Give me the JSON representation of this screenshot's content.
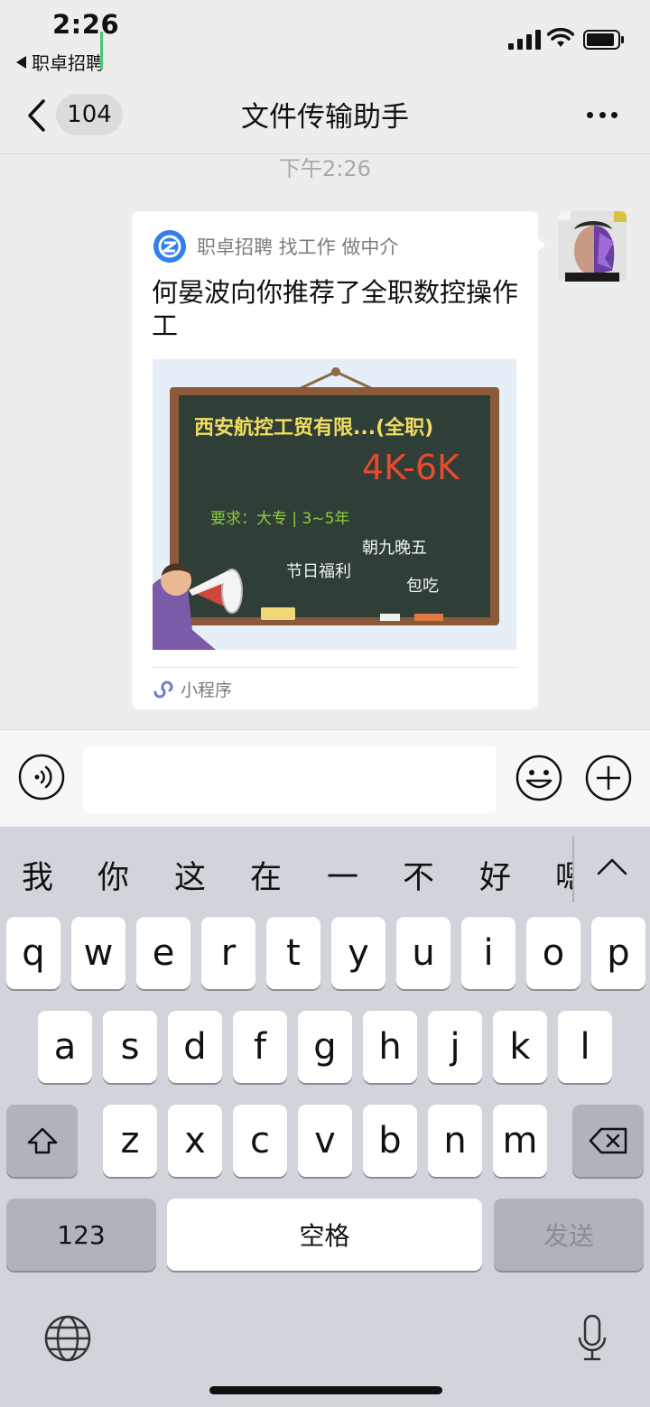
{
  "status_bar": {
    "time": "2:26",
    "back_app_label": "职卓招聘"
  },
  "nav": {
    "unread_count": "104",
    "title": "文件传输助手"
  },
  "chat": {
    "timestamp": "下午2:26",
    "card": {
      "source": "职卓招聘 找工作 做中介",
      "title": "何晏波向你推荐了全职数控操作工",
      "image": {
        "company": "西安航控工贸有限...(全职)",
        "salary": "4K-6K",
        "requirements": "要求：大专 | 3~5年",
        "benefit_1": "朝九晚五",
        "benefit_2": "节日福利",
        "benefit_3": "包吃"
      },
      "footer_label": "小程序"
    }
  },
  "input_bar": {
    "text_value": ""
  },
  "keyboard": {
    "candidates": [
      "我",
      "你",
      "这",
      "在",
      "一",
      "不",
      "好",
      "嗯"
    ],
    "row1": [
      "q",
      "w",
      "e",
      "r",
      "t",
      "y",
      "u",
      "i",
      "o",
      "p"
    ],
    "row2": [
      "a",
      "s",
      "d",
      "f",
      "g",
      "h",
      "j",
      "k",
      "l"
    ],
    "row3": [
      "z",
      "x",
      "c",
      "v",
      "b",
      "n",
      "m"
    ],
    "numbers_label": "123",
    "space_label": "空格",
    "send_label": "发送"
  },
  "colors": {
    "accent_green": "#4cc47a",
    "chalkboard": "#2f3f37",
    "salary_red": "#e84a2f"
  },
  "icons": [
    "back-chevron-icon",
    "signal-icon",
    "wifi-icon",
    "battery-icon",
    "more-icon",
    "voice-icon",
    "emoji-icon",
    "plus-icon",
    "miniprogram-icon",
    "shift-icon",
    "delete-icon",
    "globe-icon",
    "mic-icon",
    "chevron-up-icon"
  ]
}
